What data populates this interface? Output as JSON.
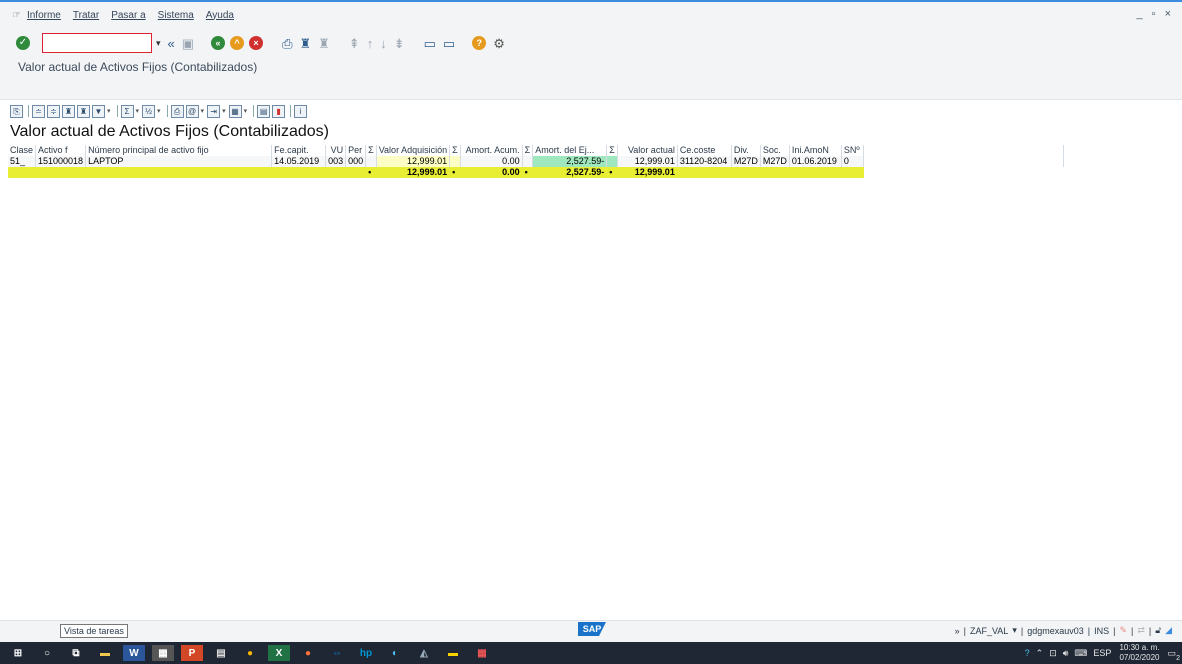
{
  "menubar": {
    "items": [
      "Informe",
      "Tratar",
      "Pasar a",
      "Sistema",
      "Ayuda"
    ],
    "window_controls": "_ ▫ ×"
  },
  "screen": {
    "title": "Valor actual de Activos Fijos (Contabilizados)"
  },
  "report": {
    "title": "Valor actual de Activos Fijos (Contabilizados)",
    "columns": [
      "Clase",
      "Activo f",
      "Número principal de activo fijo",
      "Fe.capit.",
      "VU",
      "Per",
      "Σ",
      "Valor Adquisición",
      "Σ",
      "Amort. Acum.",
      "Σ",
      "Amort. del Ej...",
      "Σ",
      "Valor actual",
      "Ce.coste",
      "Div.",
      "Soc.",
      "Ini.AmoN",
      "SNº"
    ],
    "row": {
      "clase": "51_",
      "activo": "151000018",
      "descripcion": "LAPTOP",
      "fecapit": "14.05.2019",
      "vu": "003",
      "per": "000",
      "valor_adq": "12,999.01",
      "amort_acum": "0.00",
      "amort_ej": "2,527.59-",
      "valor_actual": "12,999.01",
      "ce_coste": "31120-8204",
      "div": "M27D",
      "soc": "M27D",
      "ini_amon": "01.06.2019",
      "snr": "0"
    },
    "totals": {
      "valor_adq": "12,999.01",
      "amort_acum": "0.00",
      "amort_ej": "2,527.59-",
      "valor_actual": "12,999.01",
      "marker": "•"
    }
  },
  "statusbar": {
    "tooltip": "Vista de tareas",
    "sap_logo": "SAP",
    "prefix": "»",
    "transaction": "ZAF_VAL",
    "server": "gdgmexauv03",
    "mode": "INS"
  },
  "taskbar": {
    "lang": "ESP",
    "time": "10:30 a. m.",
    "date": "07/02/2020",
    "notif_count": "2"
  },
  "colors": {
    "total_row": "#e8ee33",
    "valor_adq_cell": "#fdfec4",
    "amort_ej_cell": "#9fe7bd",
    "accent": "#3a8dde"
  }
}
